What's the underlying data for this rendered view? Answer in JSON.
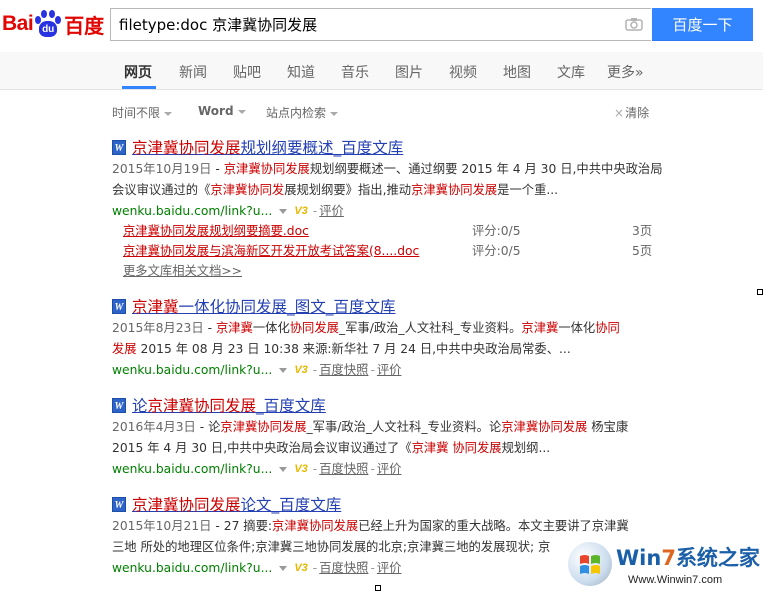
{
  "logo": {
    "text_left": "Bai",
    "text_mid": "du",
    "text_right": "百度"
  },
  "search": {
    "query": "filetype:doc 京津冀协同发展",
    "button": "百度一下",
    "camera_icon": "camera-icon"
  },
  "tabs": [
    "网页",
    "新闻",
    "贴吧",
    "知道",
    "音乐",
    "图片",
    "视频",
    "地图",
    "文库",
    "更多»"
  ],
  "filters": {
    "time": "时间不限",
    "type": "Word",
    "site": "站点内检索",
    "clear": "清除"
  },
  "results": [
    {
      "title_em": "京津冀协同发展",
      "title_rest": "规划纲要概述_百度文库",
      "date": "2015年10月19日",
      "line1_pre": " - ",
      "line1_em": "京津冀协同发展",
      "line1_post": "规划纲要概述一、通过纲要 2015 年 4 月 30 日,中共中央政治局",
      "line2_pre": "会议审议通过的《",
      "line2_em": "京津冀协同发",
      "line2_mid": "展规划纲要》指出,推动",
      "line2_em2": "京津冀协同发展",
      "line2_post": "是一个重...",
      "url": "wenku.baidu.com/link?u...",
      "link1": "评价",
      "subs": [
        {
          "title": "京津冀协同发展规划纲要摘要.doc",
          "score": "评分:0/5",
          "pages": "3页"
        },
        {
          "title": "京津冀协同发展与滨海新区开发开放考试答案(8....doc",
          "score": "评分:0/5",
          "pages": "5页"
        }
      ],
      "more": "更多文库相关文档>>"
    },
    {
      "title_em": "京津冀",
      "title_rest": "一体化协同发展_图文_百度文库",
      "date": "2015年8月23日",
      "line1_pre": " - ",
      "line1_em": "京津冀",
      "line1_mid": "一体化",
      "line1_em2": "协同发展",
      "line1_post": "_军事/政治_人文社科_专业资料。",
      "line1_em3": "京津冀",
      "line1_tail": "一体化",
      "line1_em4": "协同",
      "line2_em": "发展",
      "line2_post": " 2015 年 08 月 23 日 10:38 来源:新华社 7 月 24 日,中共中央政治局常委、...",
      "url": "wenku.baidu.com/link?u...",
      "link1": "百度快照",
      "link2": "评价"
    },
    {
      "title_pre": "论",
      "title_em": "京津冀协同发展",
      "title_rest": "_百度文库",
      "date": "2016年4月3日",
      "line1_pre": " - 论",
      "line1_em": "京津冀协同发展",
      "line1_post": "_军事/政治_人文社科_专业资料。论",
      "line1_em2": "京津冀协同发展",
      "line1_tail": " 杨宝康",
      "line2_pre": "2015 年 4 月 30 日,中共中央政治局会议审议通过了《",
      "line2_em": "京津冀 协同发展",
      "line2_post": "规划纲...",
      "url": "wenku.baidu.com/link?u...",
      "link1": "百度快照",
      "link2": "评价"
    },
    {
      "title_em": "京津冀协同发展",
      "title_rest": "论文_百度文库",
      "date": "2015年10月21日",
      "line1_pre": " - 27 摘要:",
      "line1_em": "京津冀协同发展",
      "line1_post": "已经上升为国家的重大战略。本文主要讲了京津冀",
      "line2": "三地 所处的地理区位条件;京津冀三地协同发展的北京;京津冀三地的发展现状; 京",
      "url": "wenku.baidu.com/link?u...",
      "link1": "百度快照",
      "link2": "评价"
    }
  ],
  "watermark": {
    "title_a": "Win",
    "title_b": "7",
    "title_c": "系统之家",
    "url": "Www.Winwin7.com"
  },
  "colors": {
    "accent": "#3385ff",
    "brand_red": "#e10602",
    "link_blue": "#2440b3",
    "em_red": "#cc0000",
    "url_green": "#008000"
  }
}
